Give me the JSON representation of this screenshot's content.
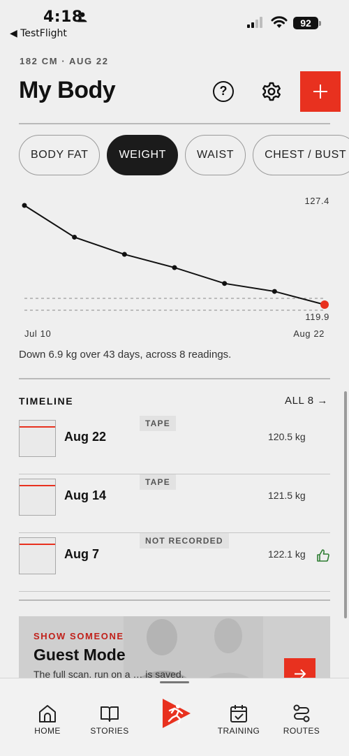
{
  "status_bar": {
    "time": "4:18",
    "back_app": "◀ TestFlight",
    "battery": "92"
  },
  "header": {
    "meta": "182 CM · AUG 22",
    "title": "My Body",
    "help_glyph": "?"
  },
  "tabs": [
    "BODY FAT",
    "WEIGHT",
    "WAIST",
    "CHEST / BUST"
  ],
  "active_tab": "WEIGHT",
  "chart_data": {
    "type": "line",
    "x_start_label": "Jul 10",
    "x_end_label": "Aug 22",
    "max_label": "127.4",
    "min_label": "119.9",
    "series": [
      {
        "values": [
          127.4,
          125.0,
          123.7,
          122.7,
          121.5,
          120.9,
          119.9
        ]
      }
    ],
    "highlight_color": "#e8311f",
    "line_color": "#111111"
  },
  "summary": "Down 6.9 kg over 43 days, across 8 readings.",
  "timeline": {
    "title": "TIMELINE",
    "all_link": "ALL 8 →",
    "rows": [
      {
        "date": "Aug 22",
        "tag": "TAPE",
        "value": "120.5 kg",
        "liked": false
      },
      {
        "date": "Aug 14",
        "tag": "TAPE",
        "value": "121.5 kg",
        "liked": false
      },
      {
        "date": "Aug 7",
        "tag": "NOT RECORDED",
        "value": "122.1 kg",
        "liked": true
      }
    ]
  },
  "promo": {
    "eyebrow": "SHOW SOMEONE",
    "title": "Guest Mode",
    "body": "The full scan, run on a … is saved."
  },
  "nav": {
    "items": [
      {
        "label": "HOME",
        "icon": "home-icon"
      },
      {
        "label": "STORIES",
        "icon": "book-icon"
      },
      {
        "label": "TRAINING",
        "icon": "calendar-icon"
      },
      {
        "label": "ROUTES",
        "icon": "route-icon"
      }
    ],
    "center_icon": "runner-icon",
    "accent": "#e8311f"
  }
}
